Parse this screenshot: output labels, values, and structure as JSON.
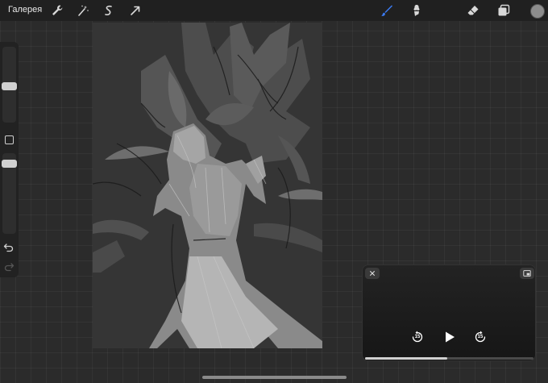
{
  "topbar": {
    "gallery_label": "Галерея",
    "left_tools": [
      {
        "name": "wrench-icon"
      },
      {
        "name": "magic-wand-icon"
      },
      {
        "name": "selection-icon"
      },
      {
        "name": "transform-arrow-icon"
      }
    ],
    "right_tools": [
      {
        "name": "brush-icon",
        "active_color": "#3b7cf5"
      },
      {
        "name": "smudge-icon"
      },
      {
        "name": "eraser-icon"
      },
      {
        "name": "layers-icon"
      }
    ],
    "current_color": "#8c8c8c"
  },
  "sidebar": {
    "brush_size_slider": {
      "name": "brush-size-slider"
    },
    "opacity_slider": {
      "name": "opacity-slider"
    },
    "modify_button": {
      "name": "modify-button"
    },
    "undo": {
      "name": "undo-icon"
    },
    "redo": {
      "name": "redo-icon"
    }
  },
  "canvas": {
    "description_icon": "sketch-artwork"
  },
  "pip_player": {
    "close_icon": "close-icon",
    "expand_icon": "pip-expand-icon",
    "rewind_label": "15",
    "forward_label": "15",
    "progress": 0.49
  }
}
